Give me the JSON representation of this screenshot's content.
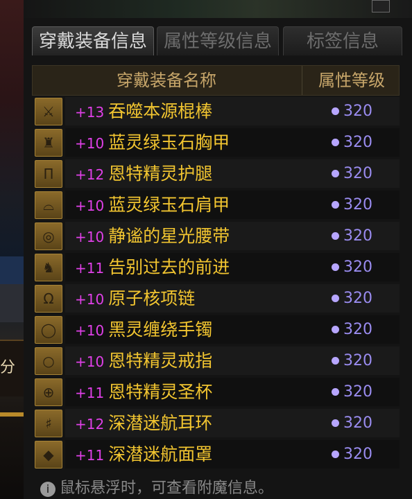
{
  "side_text": "分",
  "tabs": [
    {
      "label": "穿戴装备信息"
    },
    {
      "label": "属性等级信息"
    },
    {
      "label": "标签信息"
    }
  ],
  "table": {
    "header_name": "穿戴装备名称",
    "header_level": "属性等级",
    "rows": [
      {
        "icon": "weapon-icon",
        "glyph": "⚔",
        "plus": "+13",
        "name": "吞噬本源棍棒",
        "level": "320"
      },
      {
        "icon": "chest-armor-icon",
        "glyph": "♜",
        "plus": "+10",
        "name": "蓝灵绿玉石胸甲",
        "level": "320"
      },
      {
        "icon": "leg-armor-icon",
        "glyph": "Π",
        "plus": "+12",
        "name": "恩特精灵护腿",
        "level": "320"
      },
      {
        "icon": "shoulder-armor-icon",
        "glyph": "⌓",
        "plus": "+10",
        "name": "蓝灵绿玉石肩甲",
        "level": "320"
      },
      {
        "icon": "belt-icon",
        "glyph": "◎",
        "plus": "+10",
        "name": "静谧的星光腰带",
        "level": "320"
      },
      {
        "icon": "boots-icon",
        "glyph": "♞",
        "plus": "+11",
        "name": "告别过去的前进",
        "level": "320"
      },
      {
        "icon": "necklace-icon",
        "glyph": "Ω",
        "plus": "+10",
        "name": "原子核项链",
        "level": "320"
      },
      {
        "icon": "bracelet-icon",
        "glyph": "◯",
        "plus": "+10",
        "name": "黑灵缠绕手镯",
        "level": "320"
      },
      {
        "icon": "ring-icon",
        "glyph": "○",
        "plus": "+10",
        "name": "恩特精灵戒指",
        "level": "320"
      },
      {
        "icon": "subequip-icon",
        "glyph": "⊕",
        "plus": "+11",
        "name": "恩特精灵圣杯",
        "level": "320"
      },
      {
        "icon": "earring-icon",
        "glyph": "♯",
        "plus": "+12",
        "name": "深潜迷航耳环",
        "level": "320"
      },
      {
        "icon": "magic-stone-icon",
        "glyph": "◆",
        "plus": "+11",
        "name": "深潜迷航面罩",
        "level": "320"
      }
    ]
  },
  "footer": {
    "hint": "鼠标悬浮时，可查看附魔信息。"
  },
  "colors": {
    "item_name": "#f2c530",
    "enhance": "#e040e8",
    "level": "#9a8cf0"
  }
}
